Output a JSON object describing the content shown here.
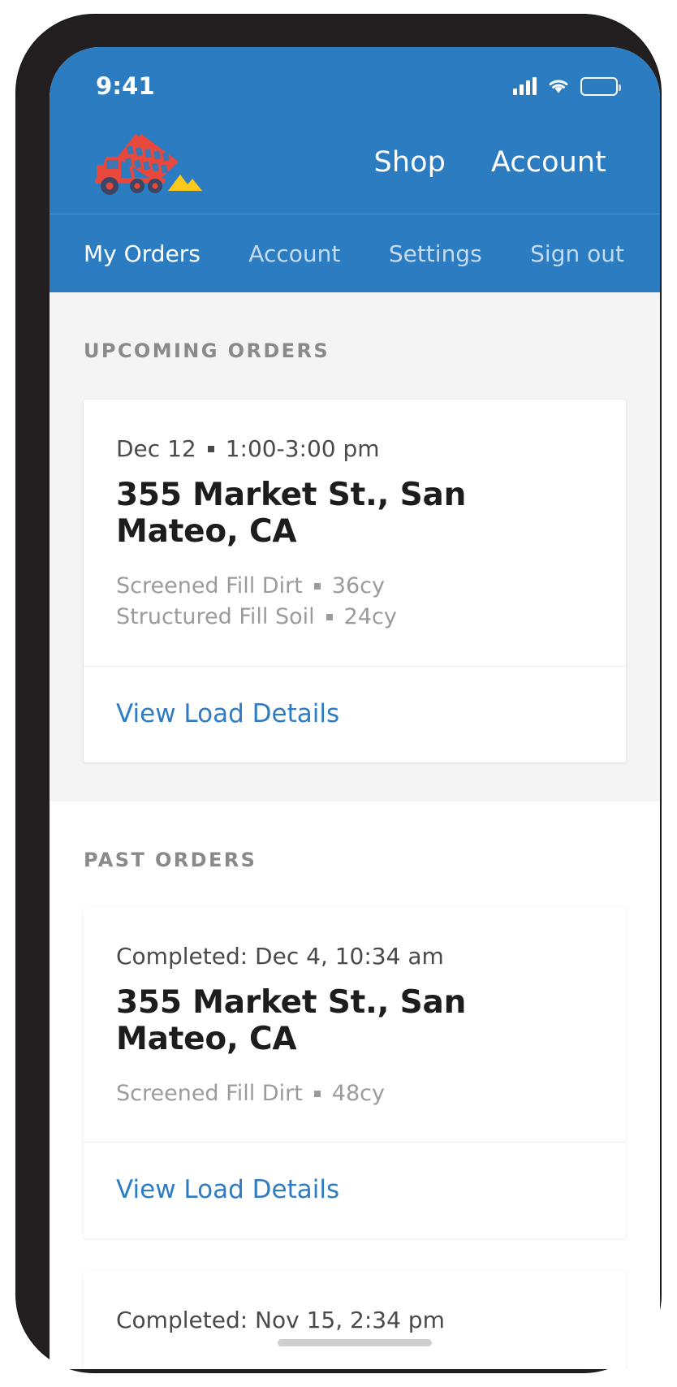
{
  "status_bar": {
    "time": "9:41",
    "signal_icon": "cellular-signal-icon",
    "wifi_icon": "wifi-icon",
    "battery_icon": "battery-full-icon"
  },
  "header": {
    "logo_icon": "dump-truck-logo",
    "logo_colors": {
      "truck": "#e8483c",
      "wheels": "#3b4664",
      "dirt_pile": "#ffc91b"
    },
    "nav": [
      {
        "label": "Shop"
      },
      {
        "label": "Account"
      }
    ]
  },
  "sub_nav": {
    "items": [
      {
        "label": "My Orders",
        "active": true
      },
      {
        "label": "Account",
        "active": false
      },
      {
        "label": "Settings",
        "active": false
      },
      {
        "label": "Sign out",
        "active": false
      }
    ]
  },
  "colors": {
    "brand_blue": "#2b7cc0",
    "link_blue": "#2e7cc4",
    "page_gray": "#f4f4f4",
    "muted_text": "#9b9b9b"
  },
  "upcoming": {
    "title": "UPCOMING ORDERS",
    "orders": [
      {
        "date": "Dec 12",
        "time_window": "1:00-3:00 pm",
        "address": "355 Market St., San Mateo, CA",
        "materials": [
          {
            "name": "Screened Fill Dirt",
            "quantity": "36cy"
          },
          {
            "name": "Structured Fill Soil",
            "quantity": "24cy"
          }
        ],
        "link_label": "View Load Details"
      }
    ]
  },
  "past": {
    "title": "PAST ORDERS",
    "orders": [
      {
        "status_line": "Completed: Dec 4, 10:34 am",
        "address": "355 Market St., San Mateo, CA",
        "materials": [
          {
            "name": "Screened Fill Dirt",
            "quantity": "48cy"
          }
        ],
        "link_label": "View Load Details"
      },
      {
        "status_line": "Completed: Nov 15, 2:34 pm"
      }
    ]
  }
}
